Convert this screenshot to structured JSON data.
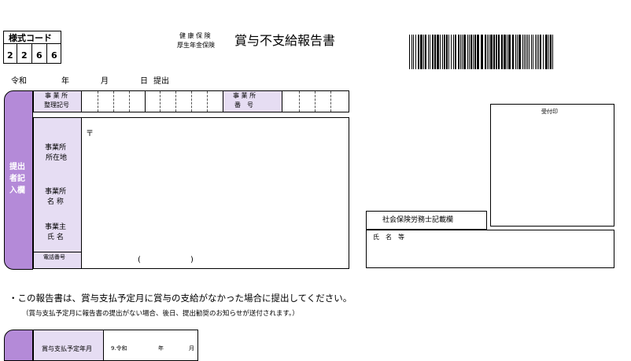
{
  "form_code": {
    "label": "様式コード",
    "digits": [
      "2",
      "2",
      "6",
      "6"
    ]
  },
  "header": {
    "insurance_line1": "健 康 保 険",
    "insurance_line2": "厚生年金保険",
    "title": "賞与不支給報告書"
  },
  "date_line": {
    "era": "令和",
    "year": "年",
    "month": "月",
    "day": "日",
    "submit": "提出"
  },
  "submitter": {
    "side_label": "提出者記入欄",
    "office_reg_label_1": "事 業 所",
    "office_reg_label_2": "整理記号",
    "office_no_label_1": "事 業 所",
    "office_no_label_2": "番　号",
    "postal_mark": "〒",
    "address_label_1": "事業所",
    "address_label_2": "所在地",
    "name_label_1": "事業所",
    "name_label_2": "名 称",
    "owner_label_1": "事業主",
    "owner_label_2": "氏 名",
    "phone_label": "電話番号",
    "phone_paren_open": "(",
    "phone_paren_close": ")"
  },
  "receipt": {
    "label": "受付印"
  },
  "sharoushi": {
    "title": "社会保険労務士記載欄",
    "name_label": "氏　名　等"
  },
  "notes": {
    "line1": "・この報告書は、賞与支払予定月に賞与の支給がなかった場合に提出してください。",
    "line2": "（賞与支払予定月に報告書の提出がない場合、後日、提出勧奨のお知らせが送付されます。）"
  },
  "bottom": {
    "label": "賞与支払予定年月",
    "era": "9.令和",
    "year": "年",
    "month": "月"
  }
}
